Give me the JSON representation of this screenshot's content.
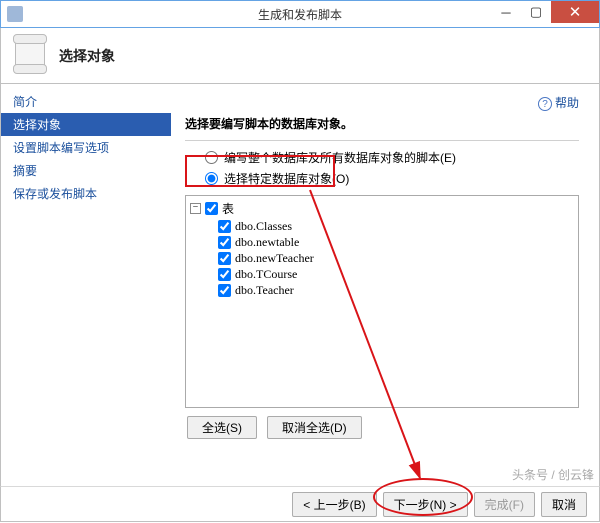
{
  "window": {
    "title": "生成和发布脚本"
  },
  "banner": {
    "heading": "选择对象"
  },
  "sidebar": {
    "items": [
      {
        "label": "简介"
      },
      {
        "label": "选择对象"
      },
      {
        "label": "设置脚本编写选项"
      },
      {
        "label": "摘要"
      },
      {
        "label": "保存或发布脚本"
      }
    ]
  },
  "content": {
    "help": "帮助",
    "instruction": "选择要编写脚本的数据库对象。",
    "radio_all": "编写整个数据库及所有数据库对象的脚本(E)",
    "radio_specific": "选择特定数据库对象(O)",
    "tree": {
      "root": "表",
      "children": [
        "dbo.Classes",
        "dbo.newtable",
        "dbo.newTeacher",
        "dbo.TCourse",
        "dbo.Teacher"
      ]
    },
    "select_all": "全选(S)",
    "deselect_all": "取消全选(D)"
  },
  "footer": {
    "back": "< 上一步(B)",
    "next": "下一步(N) >",
    "finish": "完成(F)",
    "cancel": "取消"
  },
  "watermark": "头条号 / 创云锋"
}
